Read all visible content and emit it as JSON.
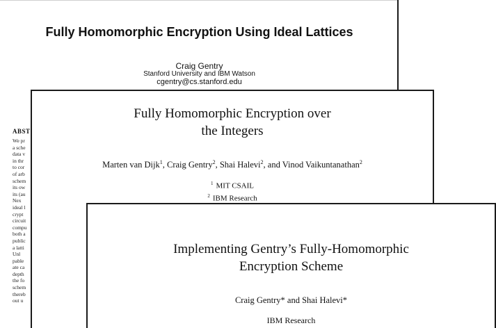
{
  "paper1": {
    "title": "Fully Homomorphic Encryption Using Ideal Lattices",
    "author": "Craig Gentry",
    "affiliation": "Stanford University and IBM Watson",
    "email": "cgentry@cs.stanford.edu",
    "abstract_heading": "ABST",
    "abstract_fragments": [
      "We pr",
      "a sche",
      "data v",
      "in thr",
      "to cor",
      "of arb",
      "schem",
      "its ow",
      "its (au",
      "Nex",
      "ideal l",
      "crypt",
      "circuit",
      "compu",
      "both a",
      "public",
      "a latti",
      "Unl",
      "pable",
      "ate ca",
      "depth",
      "the fo",
      "schem",
      "thereb",
      "out u"
    ]
  },
  "paper2": {
    "title_line1": "Fully Homomorphic Encryption over",
    "title_line2": "the Integers",
    "authors": [
      {
        "name": "Marten van Dijk",
        "sup": "1",
        "sep": ", "
      },
      {
        "name": "Craig Gentry",
        "sup": "2",
        "sep": ", "
      },
      {
        "name": "Shai Halevi",
        "sup": "2",
        "sep": ", and "
      },
      {
        "name": "Vinod Vaikuntanathan",
        "sup": "2",
        "sep": ""
      }
    ],
    "affiliations": [
      {
        "sup": "1",
        "name": "MIT CSAIL"
      },
      {
        "sup": "2",
        "name": "IBM Research"
      }
    ]
  },
  "paper3": {
    "title_line1": "Implementing Gentry’s Fully-Homomorphic",
    "title_line2": "Encryption Scheme",
    "authors": "Craig Gentry* and Shai Halevi*",
    "institution": "IBM Research"
  }
}
